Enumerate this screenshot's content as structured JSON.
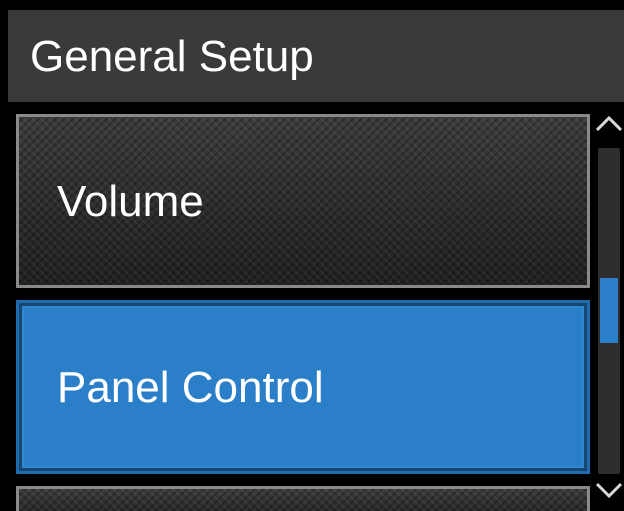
{
  "header": {
    "title": "General Setup"
  },
  "menu": {
    "items": [
      {
        "label": "Volume",
        "selected": false
      },
      {
        "label": "Panel Control",
        "selected": true
      },
      {
        "label": "",
        "selected": false
      }
    ]
  },
  "scrollbar": {
    "up_icon": "chevron-up-icon",
    "down_icon": "chevron-down-icon",
    "thumb_start": 0.4,
    "thumb_fraction": 0.2
  },
  "colors": {
    "title_bar": "#3a3a3c",
    "selected_item": "#2a7fc8",
    "unselected_item": "#303030",
    "text": "#ffffff",
    "background": "#000000"
  }
}
